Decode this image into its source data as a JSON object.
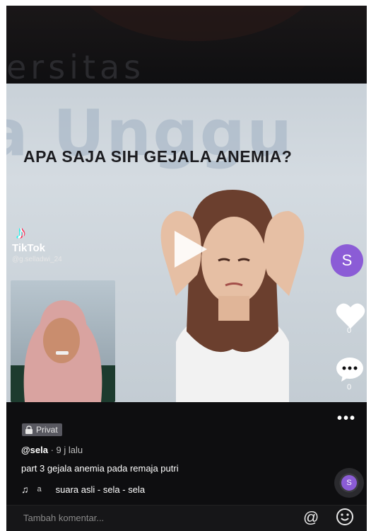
{
  "watermark": {
    "top_text": "ersitas",
    "big_text": "a Unggu"
  },
  "video": {
    "headline": "APA SAJA SIH GEJALA ANEMIA?",
    "tiktok_word": "TikTok",
    "tiktok_handle": "@g.selladwi_24"
  },
  "sidebar": {
    "avatar_letter": "S",
    "like_count": "0",
    "comment_count": "0",
    "more_label": "•••"
  },
  "post": {
    "privacy_label": "Privat",
    "username": "@sela",
    "time": " · 9 j lalu",
    "caption": "part 3 gejala anemia pada remaja putri",
    "music_prefix": "a",
    "music_title": "suara asli - sela - sela",
    "disc_letter": "S"
  },
  "comment_bar": {
    "placeholder": "Tambah komentar..."
  },
  "colors": {
    "accent": "#8b5cd6",
    "background": "#0e0e10"
  }
}
